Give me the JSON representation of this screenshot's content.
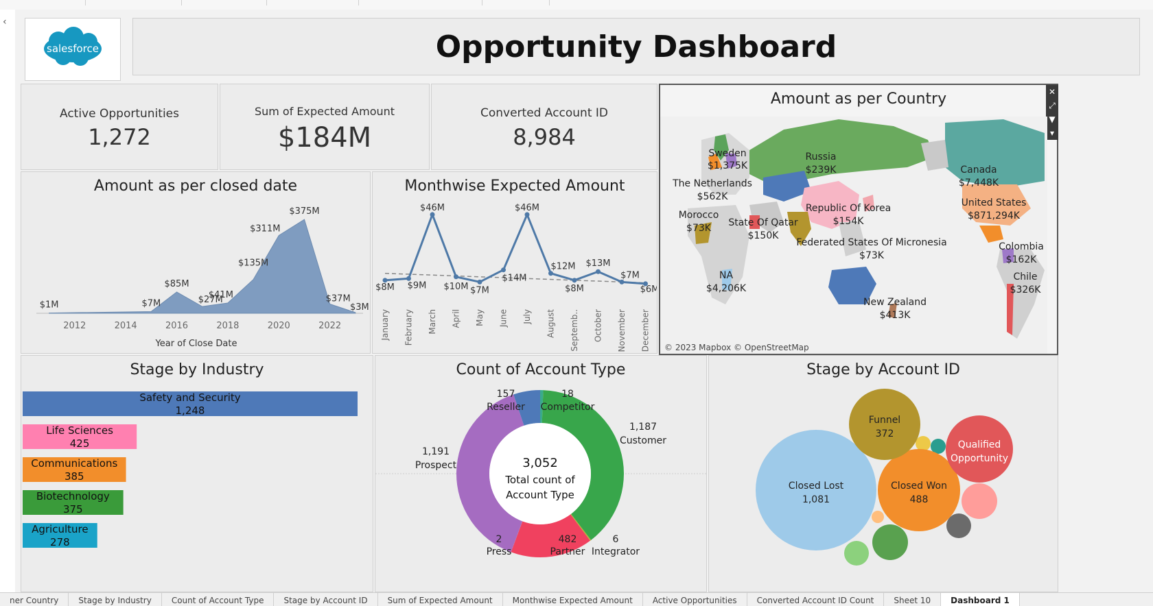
{
  "dashboard": {
    "title": "Opportunity Dashboard",
    "logo_text": "salesforce",
    "brand_color": "#1798c1"
  },
  "kpis": [
    {
      "label": "Active Opportunities",
      "value": "1,272"
    },
    {
      "label": "Sum of Expected Amount",
      "value": "$184M"
    },
    {
      "label": "Converted Account ID",
      "value": "8,984"
    }
  ],
  "map": {
    "title": "Amount as per Country",
    "attribution": "© 2023 Mapbox © OpenStreetMap",
    "labels": [
      {
        "name": "Sweden",
        "value": "$1,375K"
      },
      {
        "name": "Russia",
        "value": "$239K"
      },
      {
        "name": "Canada",
        "value": "$7,448K"
      },
      {
        "name": "The Netherlands",
        "value": "$562K"
      },
      {
        "name": "Morocco",
        "value": "$73K"
      },
      {
        "name": "State Of Qatar",
        "value": "$150K"
      },
      {
        "name": "Republic Of Korea",
        "value": "$154K"
      },
      {
        "name": "United States",
        "value": "$871,294K"
      },
      {
        "name": "Federated States Of Micronesia",
        "value": "$73K"
      },
      {
        "name": "Colombia",
        "value": "$162K"
      },
      {
        "name": "NA",
        "value": "$4,206K"
      },
      {
        "name": "Chile",
        "value": "$326K"
      },
      {
        "name": "New Zealand",
        "value": "$413K"
      }
    ],
    "tool_icons": [
      "close-icon",
      "popout-icon",
      "filter-icon",
      "more-icon"
    ]
  },
  "charts": {
    "closed_date": {
      "type": "area",
      "title": "Amount as per closed date",
      "xlabel": "Year of Close Date",
      "x": [
        2011,
        2015,
        2016,
        2017,
        2018,
        2019,
        2020,
        2021,
        2022,
        2023
      ],
      "values": [
        1,
        7,
        85,
        27,
        41,
        135,
        311,
        375,
        37,
        3
      ],
      "labels": [
        "$1M",
        "$7M",
        "$85M",
        "$27M",
        "$41M",
        "$135M",
        "$311M",
        "$375M",
        "$37M",
        "$3M"
      ],
      "xticks": [
        "2012",
        "2014",
        "2016",
        "2018",
        "2020",
        "2022"
      ],
      "color": "#7f9cc0"
    },
    "monthwise": {
      "type": "line",
      "title": "Monthwise Expected Amount",
      "categories": [
        "January",
        "February",
        "March",
        "April",
        "May",
        "June",
        "July",
        "August",
        "Septemb..",
        "October",
        "November",
        "December"
      ],
      "values": [
        8,
        9,
        46,
        10,
        7,
        14,
        46,
        12,
        8,
        13,
        7,
        6
      ],
      "labels": [
        "$8M",
        "$9M",
        "$46M",
        "$10M",
        "$7M",
        "$14M",
        "$46M",
        "$12M",
        "$8M",
        "$13M",
        "$7M",
        "$6M"
      ],
      "color": "#4e79a7"
    },
    "industry": {
      "type": "bar",
      "title": "Stage by Industry",
      "categories": [
        "Safety and Security",
        "Life Sciences",
        "Communications",
        "Biotechnology",
        "Agriculture"
      ],
      "values": [
        1248,
        425,
        385,
        375,
        278
      ],
      "labels": [
        "1,248",
        "425",
        "385",
        "375",
        "278"
      ],
      "colors": [
        "#4e79b8",
        "#ff80b0",
        "#f28e2b",
        "#3a9b3a",
        "#1aa3c8"
      ]
    },
    "account_type": {
      "type": "pie",
      "title": "Count of Account Type",
      "center_value": "3,052",
      "center_label_1": "Total count of",
      "center_label_2": "Account Type",
      "slices": [
        {
          "name": "Reseller",
          "value": 157,
          "label": "157",
          "color": "#4e79b8"
        },
        {
          "name": "Competitor",
          "value": 18,
          "label": "18",
          "color": "#3aaa8c"
        },
        {
          "name": "Customer",
          "value": 1187,
          "label": "1,187",
          "color": "#38a64b"
        },
        {
          "name": "Integrator",
          "value": 6,
          "label": "6",
          "color": "#b5b532"
        },
        {
          "name": "Partner",
          "value": 482,
          "label": "482",
          "color": "#f0415f"
        },
        {
          "name": "Press",
          "value": 2,
          "label": "2",
          "color": "#c05090"
        },
        {
          "name": "Prospect",
          "value": 1191,
          "label": "1,191",
          "color": "#a56cc1"
        }
      ]
    },
    "account_id": {
      "type": "bubble",
      "title": "Stage by Account ID",
      "bubbles": [
        {
          "name": "Closed Lost",
          "value": 1081,
          "value_label": "1,081",
          "color": "#9ecae9"
        },
        {
          "name": "Closed Won",
          "value": 488,
          "value_label": "488",
          "color": "#f28e2b"
        },
        {
          "name": "Funnel",
          "value": 372,
          "value_label": "372",
          "color": "#b3952e"
        },
        {
          "name": "Qualified Opportunity",
          "name_line_1": "Qualified",
          "name_line_2": "Opportunity",
          "value_label": "",
          "color": "#e15759"
        }
      ]
    }
  },
  "tabs": [
    "ner Country",
    "Stage by Industry",
    "Count of Account Type",
    "Stage by Account ID",
    "Sum of Expected Amount",
    "Monthwise Expected Amount",
    "Active Opportunities",
    "Converted Account ID Count",
    "Sheet 10",
    "Dashboard 1"
  ]
}
